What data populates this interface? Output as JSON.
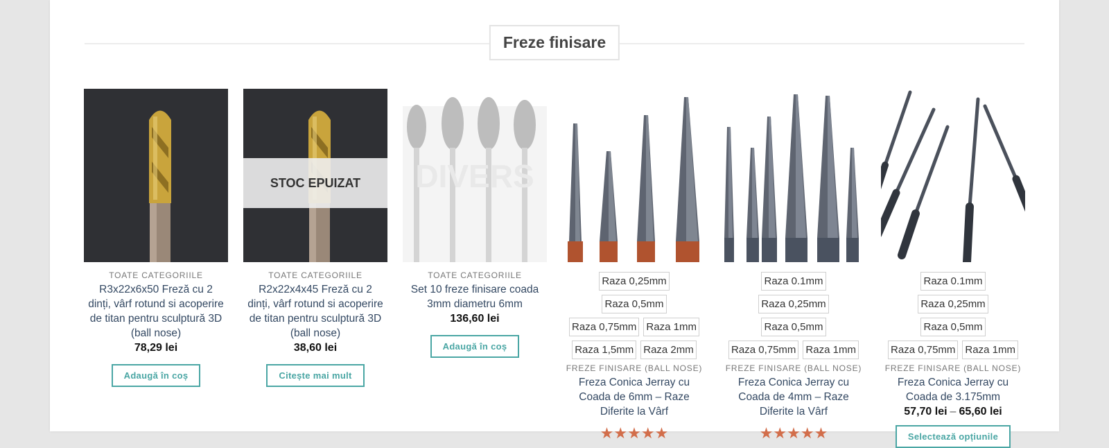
{
  "section": {
    "title": "Freze finisare"
  },
  "products": [
    {
      "category": "TOATE CATEGORIILE",
      "title": "R3x22x6x50 Freză cu 2 dinți, vârf rotund si acoperire de titan pentru sculptură 3D (ball nose)",
      "price": "78,29 lei",
      "button": "Adaugă în coș"
    },
    {
      "category": "TOATE CATEGORIILE",
      "title": "R2x22x4x45 Freză cu 2 dinți, vârf rotund si acoperire de titan pentru sculptură 3D (ball nose)",
      "price": "38,60 lei",
      "button": "Citește mai mult",
      "badge": "STOC EPUIZAT"
    },
    {
      "category": "TOATE CATEGORIILE",
      "title": "Set 10 freze finisare coada 3mm diametru 6mm",
      "price": "136,60 lei",
      "button": "Adaugă în coș",
      "watermark": "DIVERS"
    },
    {
      "variants": [
        "Raza 0,25mm",
        "Raza 0,5mm",
        "Raza 0,75mm",
        "Raza 1mm",
        "Raza 1,5mm",
        "Raza 2mm"
      ],
      "category": "FREZE FINISARE (BALL NOSE)",
      "title": "Freza Conica Jerray cu Coada de 6mm – Raze Diferite la Vârf",
      "rating": 5
    },
    {
      "variants": [
        "Raza 0.1mm",
        "Raza 0,25mm",
        "Raza 0,5mm",
        "Raza 0,75mm",
        "Raza 1mm"
      ],
      "category": "FREZE FINISARE (BALL NOSE)",
      "title": "Freza Conica Jerray cu Coada de 4mm – Raze Diferite la Vârf",
      "rating": 5
    },
    {
      "variants": [
        "Raza 0.1mm",
        "Raza 0,25mm",
        "Raza 0,5mm",
        "Raza 0,75mm",
        "Raza 1mm"
      ],
      "category": "FREZE FINISARE (BALL NOSE)",
      "title": "Freza Conica Jerray cu Coada de 3.175mm",
      "price_min": "57,70 lei",
      "price_sep": "–",
      "price_max": "65,60 lei",
      "button": "Selectează opțiunile"
    }
  ],
  "colors": {
    "accent": "#4aa6a4",
    "link": "#334862",
    "stars": "#d26e4b",
    "gold": "#c9a43c"
  },
  "icons": {
    "star": "star-icon"
  }
}
